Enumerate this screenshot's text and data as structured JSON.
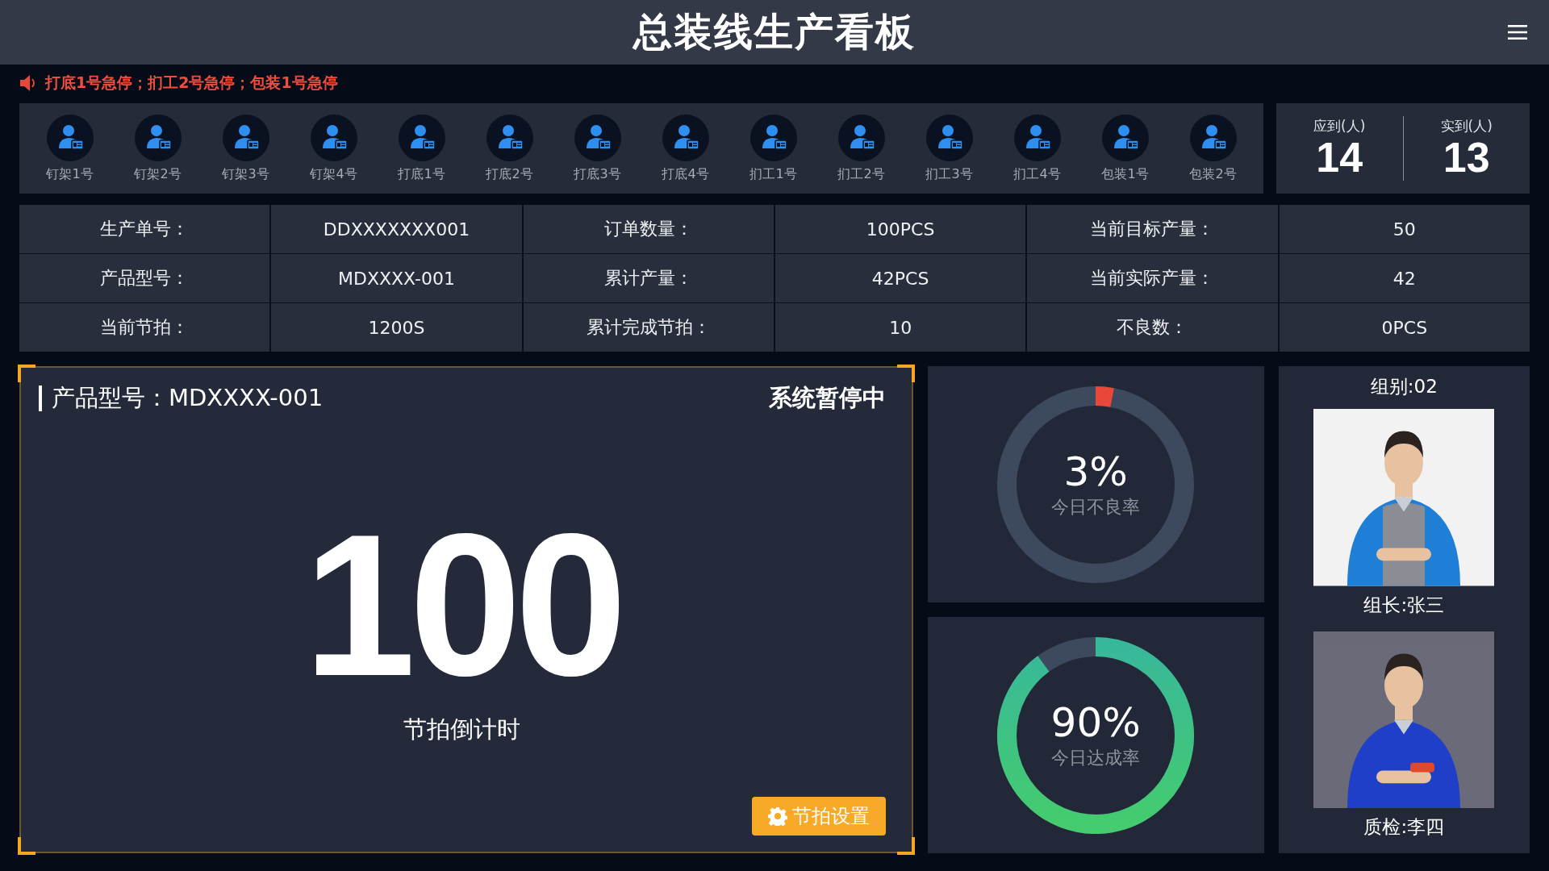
{
  "header": {
    "title": "总装线生产看板"
  },
  "alert": {
    "text": "打底1号急停；扪工2号急停；包装1号急停"
  },
  "stations": [
    {
      "label": "钉架1号"
    },
    {
      "label": "钉架2号"
    },
    {
      "label": "钉架3号"
    },
    {
      "label": "钉架4号"
    },
    {
      "label": "打底1号"
    },
    {
      "label": "打底2号"
    },
    {
      "label": "打底3号"
    },
    {
      "label": "打底4号"
    },
    {
      "label": "扪工1号"
    },
    {
      "label": "扪工2号"
    },
    {
      "label": "扪工3号"
    },
    {
      "label": "扪工4号"
    },
    {
      "label": "包装1号"
    },
    {
      "label": "包装2号"
    }
  ],
  "attendance": [
    {
      "label": "应到(人)",
      "value": "14"
    },
    {
      "label": "实到(人)",
      "value": "13"
    }
  ],
  "info_table": {
    "rows": [
      {
        "cells": [
          "生产单号：",
          "DDXXXXXXX001",
          "订单数量：",
          "100PCS",
          "当前目标产量：",
          "50"
        ]
      },
      {
        "cells": [
          "产品型号：",
          "MDXXXX-001",
          "累计产量：",
          "42PCS",
          "当前实际产量：",
          "42"
        ]
      },
      {
        "cells": [
          "当前节拍：",
          "1200S",
          "累计完成节拍：",
          "10",
          "不良数：",
          "0PCS"
        ]
      }
    ]
  },
  "countdown_panel": {
    "product": "产品型号：MDXXXX-001",
    "status": "系统暂停中",
    "value": "100",
    "caption": "节拍倒计时",
    "button": "节拍设置"
  },
  "gauges": [
    {
      "kind": "defect",
      "value": "3%",
      "label": "今日不良率"
    },
    {
      "kind": "achievement",
      "value": "90%",
      "label": "今日达成率"
    }
  ],
  "team": {
    "group": "组别:02",
    "members": [
      {
        "role": "组长:张三",
        "kind": "picture"
      },
      {
        "role": "质检:李四",
        "kind": "picture"
      }
    ]
  }
}
